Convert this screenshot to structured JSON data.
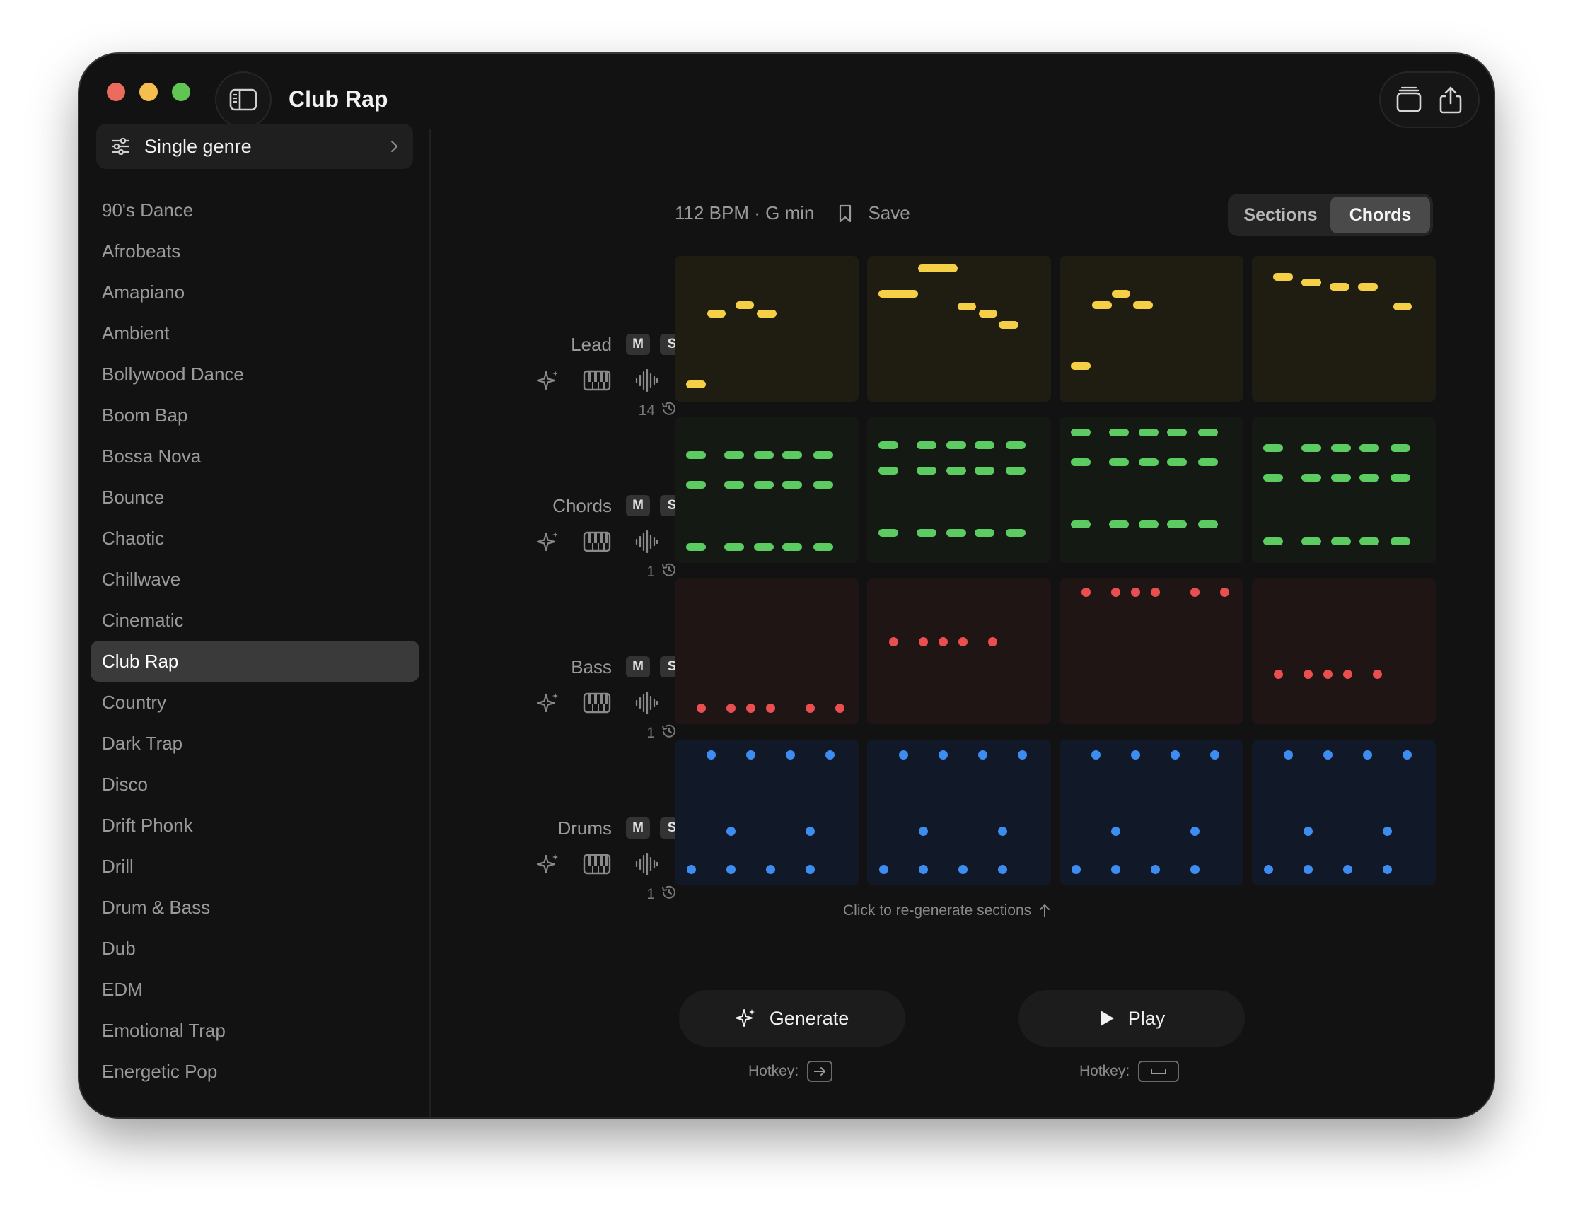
{
  "window": {
    "title": "Club Rap"
  },
  "sidebar": {
    "filter_label": "Single genre",
    "genres": [
      "90's Dance",
      "Afrobeats",
      "Amapiano",
      "Ambient",
      "Bollywood Dance",
      "Boom Bap",
      "Bossa Nova",
      "Bounce",
      "Chaotic",
      "Chillwave",
      "Cinematic",
      "Club Rap",
      "Country",
      "Dark Trap",
      "Disco",
      "Drift Phonk",
      "Drill",
      "Drum & Bass",
      "Dub",
      "EDM",
      "Emotional Trap",
      "Energetic Pop"
    ],
    "selected": "Club Rap"
  },
  "header": {
    "meta": "112 BPM · G min",
    "save_label": "Save",
    "view_tabs": [
      "Sections",
      "Chords"
    ],
    "active_tab": "Chords"
  },
  "tracks": [
    {
      "name": "Lead",
      "mute": "M",
      "solo": "S",
      "history": "14",
      "color": "#f5cf45",
      "clip_bg": "#1f1c12"
    },
    {
      "name": "Chords",
      "mute": "M",
      "solo": "S",
      "history": "1",
      "color": "#5ccb62",
      "clip_bg": "#141a13"
    },
    {
      "name": "Bass",
      "mute": "M",
      "solo": "S",
      "history": "1",
      "color": "#e94f4f",
      "clip_bg": "#1f1515"
    },
    {
      "name": "Drums",
      "mute": "M",
      "solo": "S",
      "history": "1",
      "color": "#3d8cf0",
      "clip_bg": "#111827"
    }
  ],
  "icons": {
    "sidebar_toggle": "sidebar-toggle-icon",
    "layers": "layers-icon",
    "share": "share-icon",
    "filter": "sliders-icon",
    "bookmark": "bookmark-icon",
    "sparkle": "sparkle-icon",
    "piano": "piano-icon",
    "waveform": "waveform-icon",
    "history": "history-icon",
    "play": "play-icon"
  },
  "footer": {
    "hint": "Click to re-generate sections",
    "generate_label": "Generate",
    "play_label": "Play",
    "hotkey_label": "Hotkey:"
  }
}
